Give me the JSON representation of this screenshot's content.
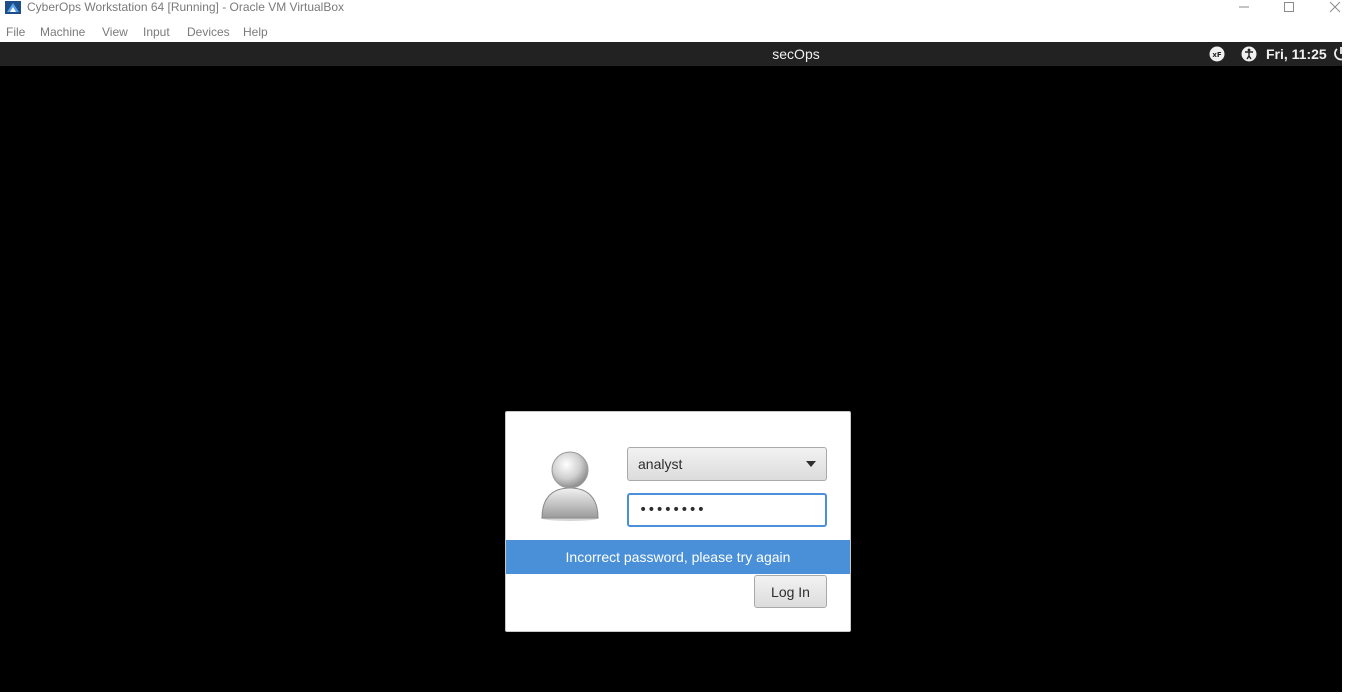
{
  "window": {
    "title": "CyberOps Workstation 64 [Running] - Oracle VM VirtualBox",
    "icon": "virtualbox-icon",
    "controls": {
      "minimize": "minimize-icon",
      "maximize": "maximize-icon",
      "close": "close-icon"
    }
  },
  "menubar": {
    "items": [
      {
        "label": "File"
      },
      {
        "label": "Machine"
      },
      {
        "label": "View"
      },
      {
        "label": "Input"
      },
      {
        "label": "Devices"
      },
      {
        "label": "Help"
      }
    ]
  },
  "guest_panel": {
    "hostname": "secOps",
    "tray_icons": [
      "keyboard-layout-icon",
      "accessibility-icon",
      "power-icon"
    ],
    "clock": "Fri, 11:25"
  },
  "login": {
    "avatar_icon": "user-avatar-icon",
    "selected_user": "analyst",
    "password_value": "••••••••",
    "error_message": "Incorrect password, please try again",
    "login_button": "Log In"
  },
  "colors": {
    "accent": "#4a90d9",
    "panel_bg": "#222222",
    "screen_bg": "#000000"
  }
}
